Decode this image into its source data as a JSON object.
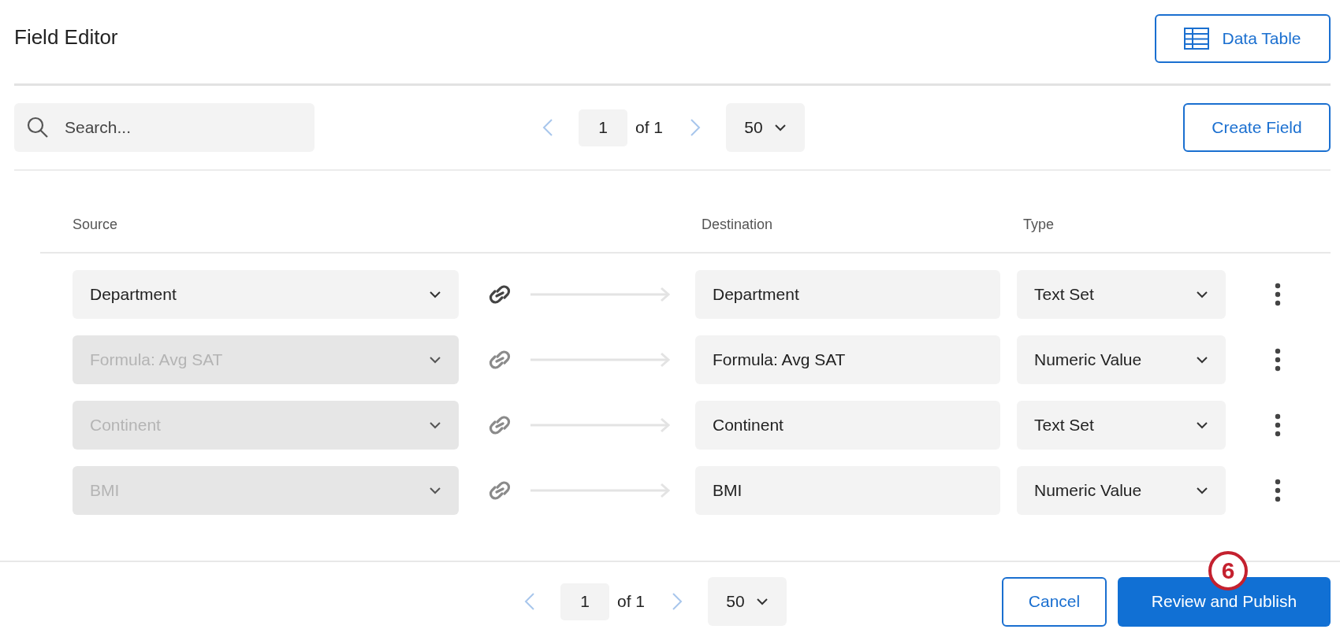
{
  "title": "Field Editor",
  "header_button": {
    "label": "Data Table"
  },
  "search": {
    "placeholder": "Search..."
  },
  "top_pager": {
    "page": "1",
    "of": "of 1",
    "page_size": "50",
    "prev_disabled": true,
    "next_disabled": true
  },
  "create_button": {
    "label": "Create Field"
  },
  "table": {
    "columns": [
      "Source",
      "Destination",
      "Type"
    ],
    "rows": [
      {
        "source": "Department",
        "source_disabled": false,
        "destination": "Department",
        "type": "Text Set"
      },
      {
        "source": "Formula: Avg SAT",
        "source_disabled": true,
        "destination": "Formula: Avg SAT",
        "type": "Numeric Value"
      },
      {
        "source": "Continent",
        "source_disabled": true,
        "destination": "Continent",
        "type": "Text Set"
      },
      {
        "source": "BMI",
        "source_disabled": true,
        "destination": "BMI",
        "type": "Numeric Value"
      }
    ]
  },
  "bottom_pager": {
    "page": "1",
    "of": "of 1",
    "page_size": "50",
    "prev_disabled": true,
    "next_disabled": true
  },
  "footer_buttons": [
    {
      "label": "Cancel",
      "kind": "secondary"
    },
    {
      "label": "Review and Publish",
      "kind": "primary"
    }
  ],
  "step_badge": "6"
}
